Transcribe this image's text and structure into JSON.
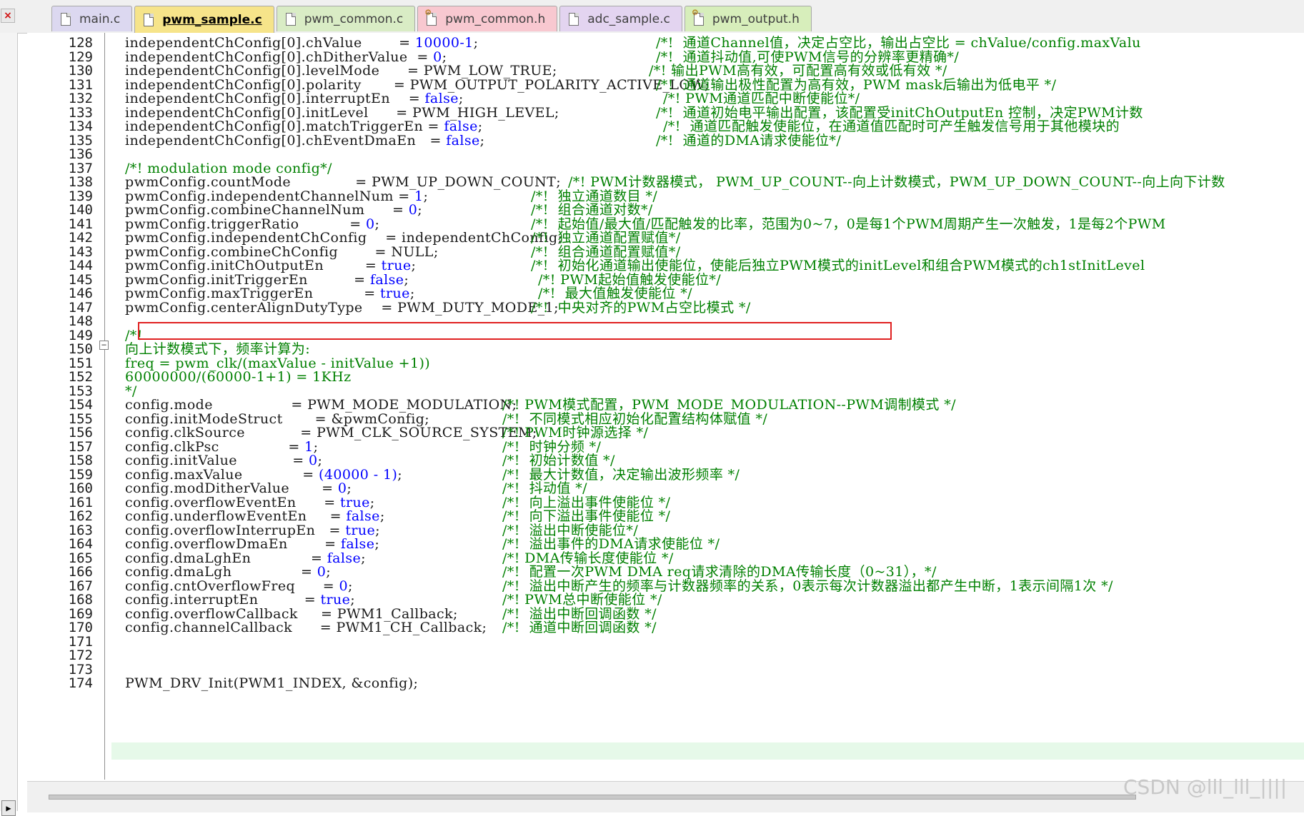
{
  "tabs": [
    {
      "label": "main.c",
      "icon": "c-file-icon",
      "bg": "#dcd8f0"
    },
    {
      "label": "pwm_sample.c",
      "icon": "c-file-icon",
      "bg": "#f6e48a",
      "active": true
    },
    {
      "label": "pwm_common.c",
      "icon": "c-file-icon",
      "bg": "#d9ecc5"
    },
    {
      "label": "pwm_common.h",
      "icon": "h-file-icon",
      "bg": "#f8c8d0"
    },
    {
      "label": "adc_sample.c",
      "icon": "c-file-icon",
      "bg": "#e3d4f0"
    },
    {
      "label": "pwm_output.h",
      "icon": "h-file-icon",
      "bg": "#d7eebb"
    }
  ],
  "close_glyph": "×",
  "colors": {
    "keyword_value": "#0000ff",
    "comment": "#008000",
    "highlight_box": "#e02020",
    "current_line": "#e6f9e9"
  },
  "lines": [
    {
      "n": "128",
      "code": "independentChConfig[0].chValue        = ",
      "val": "10000-1",
      "tail": ";",
      "cmt": "/*!  通道Channel值，决定占空比，输出占空比 = chValue/config.maxValu"
    },
    {
      "n": "129",
      "code": "independentChConfig[0].chDitherValue  = ",
      "val": "0",
      "tail": ";",
      "cmt": "/*!  通道抖动值,可使PWM信号的分辨率更精确*/"
    },
    {
      "n": "130",
      "code": "independentChConfig[0].levelMode      = ",
      "val": "PWM_LOW_TRUE",
      "plain": true,
      "tail": ";",
      "cmt": "/*! 输出PWM高有效，可配置高有效或低有效 */"
    },
    {
      "n": "131",
      "code": "independentChConfig[0].polarity       = ",
      "val": "PWM_OUTPUT_POLARITY_ACTIVE_LOW",
      "plain": true,
      "tail": ";",
      "cmt": "/*!  通道输出极性配置为高有效，PWM mask后输出为低电平 */"
    },
    {
      "n": "132",
      "code": "independentChConfig[0].interruptEn    = ",
      "val": "false",
      "tail": ";",
      "cmt": "/*! PWM通道匹配中断使能位*/"
    },
    {
      "n": "133",
      "code": "independentChConfig[0].initLevel      = ",
      "val": "PWM_HIGH_LEVEL",
      "plain": true,
      "tail": ";",
      "cmt": "/*!  通道初始电平输出配置，该配置受initChOutputEn 控制，决定PWM计数"
    },
    {
      "n": "134",
      "code": "independentChConfig[0].matchTriggerEn = ",
      "val": "false",
      "tail": ";",
      "cmt": "/*!  通道匹配触发使能位，在通道值匹配时可产生触发信号用于其他模块的"
    },
    {
      "n": "135",
      "code": "independentChConfig[0].chEventDmaEn   = ",
      "val": "false",
      "tail": ";",
      "cmt": "/*!  通道的DMA请求使能位*/"
    },
    {
      "n": "136",
      "code": ""
    },
    {
      "n": "137",
      "code": "/*! modulation mode config*/",
      "comment": true
    },
    {
      "n": "138",
      "code": "pwmConfig.countMode              = ",
      "val": "PWM_UP_DOWN_COUNT",
      "plain": true,
      "tail": ";",
      "cmt": "/*! PWM计数器模式， PWM_UP_COUNT--向上计数模式，PWM_UP_DOWN_COUNT--向上向下计数"
    },
    {
      "n": "139",
      "code": "pwmConfig.independentChannelNum = ",
      "val": "1",
      "tail": ";",
      "cmt": "/*!  独立通道数目 */"
    },
    {
      "n": "140",
      "code": "pwmConfig.combineChannelNum      = ",
      "val": "0",
      "tail": ";",
      "cmt": "/*!  组合通道对数*/"
    },
    {
      "n": "141",
      "code": "pwmConfig.triggerRatio           = ",
      "val": "0",
      "tail": ";",
      "cmt": "/*!  起始值/最大值/匹配触发的比率，范围为0~7，0是每1个PWM周期产生一次触发，1是每2个PWM"
    },
    {
      "n": "142",
      "code": "pwmConfig.independentChConfig    = ",
      "val": "independentChConfig",
      "plain": true,
      "tail": ";",
      "cmt": "/*!  独立通道配置赋值*/"
    },
    {
      "n": "143",
      "code": "pwmConfig.combineChConfig        = ",
      "val": "NULL",
      "plain": true,
      "tail": ";",
      "cmt": "/*!  组合通道配置赋值*/"
    },
    {
      "n": "144",
      "code": "pwmConfig.initChOutputEn         = ",
      "val": "true",
      "tail": ";",
      "cmt": "/*!  初始化通道输出使能位，使能后独立PWM模式的initLevel和组合PWM模式的ch1stInitLevel"
    },
    {
      "n": "145",
      "code": "pwmConfig.initTriggerEn          = ",
      "val": "false",
      "tail": ";",
      "cmt": "/*! PWM起始值触发使能位*/"
    },
    {
      "n": "146",
      "code": "pwmConfig.maxTriggerEn           = ",
      "val": "true",
      "tail": ";",
      "cmt": "/*!  最大值触发使能位 */"
    },
    {
      "n": "147",
      "code": "pwmConfig.centerAlignDutyType    = ",
      "val": "PWM_DUTY_MODE_1",
      "plain": true,
      "tail": ";",
      "cmt": "/*!  中央对齐的PWM占空比模式 */"
    },
    {
      "n": "148",
      "code": ""
    },
    {
      "n": "149",
      "code": "/*!",
      "comment": true
    },
    {
      "n": "150",
      "code": "向上计数模式下，频率计算为:",
      "comment": true
    },
    {
      "n": "151",
      "code": "freq = pwm_clk/(maxValue - initValue +1))",
      "comment": true
    },
    {
      "n": "152",
      "code": "60000000/(60000-1+1) = 1KHz",
      "comment": true
    },
    {
      "n": "153",
      "code": "*/",
      "comment": true
    },
    {
      "n": "154",
      "code": "config.mode                 = ",
      "val": "PWM_MODE_MODULATION",
      "plain": true,
      "tail": ";",
      "cmt": "/*! PWM模式配置，PWM_MODE_MODULATION--PWM调制模式 */"
    },
    {
      "n": "155",
      "code": "config.initModeStruct       = ",
      "val": "&pwmConfig",
      "plain": true,
      "tail": ";",
      "cmt": "/*!  不同模式相应初始化配置结构体赋值 */"
    },
    {
      "n": "156",
      "code": "config.clkSource            = ",
      "val": "PWM_CLK_SOURCE_SYSTEM",
      "plain": true,
      "tail": ";",
      "cmt": "/*! PWM时钟源选择 */"
    },
    {
      "n": "157",
      "code": "config.clkPsc               = ",
      "val": "1",
      "tail": ";",
      "cmt": "/*!  时钟分频 */"
    },
    {
      "n": "158",
      "code": "config.initValue            = ",
      "val": "0",
      "tail": ";",
      "cmt": "/*!  初始计数值 */"
    },
    {
      "n": "159",
      "code": "config.maxValue             = ",
      "val": "(40000 - 1)",
      "tail": ";",
      "cmt": "/*!  最大计数值，决定输出波形频率 */"
    },
    {
      "n": "160",
      "code": "config.modDitherValue       = ",
      "val": "0",
      "tail": ";",
      "cmt": "/*!  抖动值 */"
    },
    {
      "n": "161",
      "code": "config.overflowEventEn      = ",
      "val": "true",
      "tail": ";",
      "cmt": "/*!  向上溢出事件使能位 */"
    },
    {
      "n": "162",
      "code": "config.underflowEventEn     = ",
      "val": "false",
      "tail": ";",
      "cmt": "/*!  向下溢出事件使能位 */"
    },
    {
      "n": "163",
      "code": "config.overflowInterrupEn   = ",
      "val": "true",
      "tail": ";",
      "cmt": "/*!  溢出中断使能位*/"
    },
    {
      "n": "164",
      "code": "config.overflowDmaEn        = ",
      "val": "false",
      "tail": ";",
      "cmt": "/*!  溢出事件的DMA请求使能位 */"
    },
    {
      "n": "165",
      "code": "config.dmaLghEn             = ",
      "val": "false",
      "tail": ";",
      "cmt": "/*! DMA传输长度使能位 */"
    },
    {
      "n": "166",
      "code": "config.dmaLgh               = ",
      "val": "0",
      "tail": ";",
      "cmt": "/*!  配置一次PWM DMA req请求清除的DMA传输长度（0~31），*/"
    },
    {
      "n": "167",
      "code": "config.cntOverflowFreq      = ",
      "val": "0",
      "tail": ";",
      "cmt": "/*!  溢出中断产生的频率与计数器频率的关系，0表示每次计数器溢出都产生中断，1表示间隔1次 */"
    },
    {
      "n": "168",
      "code": "config.interruptEn          = ",
      "val": "true",
      "tail": ";",
      "cmt": "/*! PWM总中断使能位 */"
    },
    {
      "n": "169",
      "code": "config.overflowCallback     = ",
      "val": "PWM1_Callback",
      "plain": true,
      "tail": ";",
      "cmt": "/*!  溢出中断回调函数 */"
    },
    {
      "n": "170",
      "code": "config.channelCallback      = ",
      "val": "PWM1_CH_Callback",
      "plain": true,
      "tail": ";",
      "cmt": "/*!  通道中断回调函数 */"
    },
    {
      "n": "171",
      "code": ""
    },
    {
      "n": "172",
      "code": ""
    },
    {
      "n": "173",
      "code": ""
    },
    {
      "n": "174",
      "code": "PWM_DRV_Init(PWM1_INDEX, &config);"
    }
  ],
  "watermark": "CSDN @lll_lll_||||"
}
